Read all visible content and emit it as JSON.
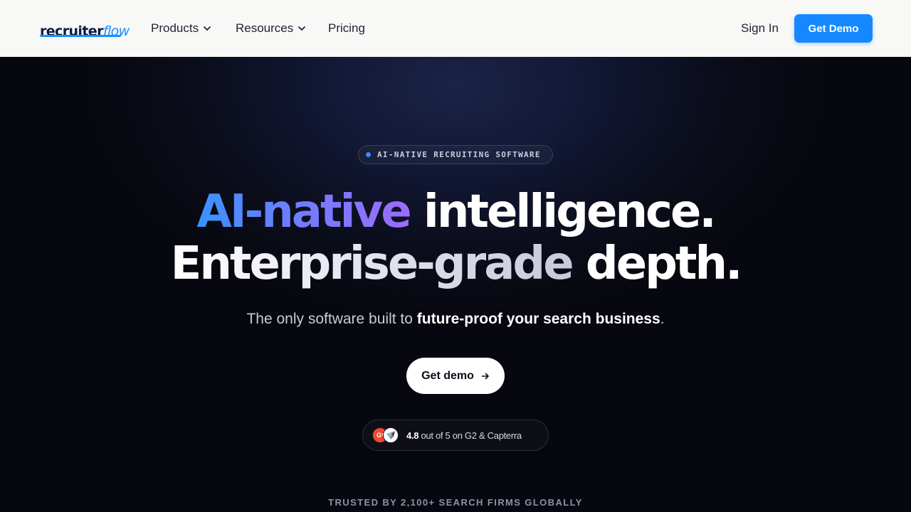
{
  "nav": {
    "logo": {
      "part1": "recruiter",
      "part2": "flow"
    },
    "links": [
      {
        "label": "Products",
        "has_dropdown": true
      },
      {
        "label": "Resources",
        "has_dropdown": true
      },
      {
        "label": "Pricing",
        "has_dropdown": false
      }
    ],
    "sign_in": "Sign In",
    "demo_button": "Get Demo"
  },
  "hero": {
    "badge": "AI-NATIVE RECRUITING SOFTWARE",
    "headline_line1": {
      "gradient": "AI-native",
      "rest": "intelligence."
    },
    "headline_line2": {
      "gradient": "Enterprise-grade",
      "rest": "depth."
    },
    "subtitle": {
      "prefix": "The only software built to ",
      "bold": "future-proof your search business",
      "suffix": "."
    },
    "cta": "Get demo",
    "rating": {
      "score": "4.8",
      "text": "out of 5 on G2 & Capterra",
      "g2_mark": "G²"
    },
    "trusted": "TRUSTED BY 2,100+ SEARCH FIRMS GLOBALLY"
  },
  "colors": {
    "accent": "#1688ff",
    "nav_bg": "#f8f8f6",
    "hero_bg": "#07080f",
    "gradient_start": "#3a92ff",
    "gradient_end": "#9b6cff"
  },
  "icons": [
    "chevron-down-icon",
    "arrow-right-icon",
    "status-dot-icon",
    "g2-logo-icon",
    "capterra-logo-icon"
  ]
}
